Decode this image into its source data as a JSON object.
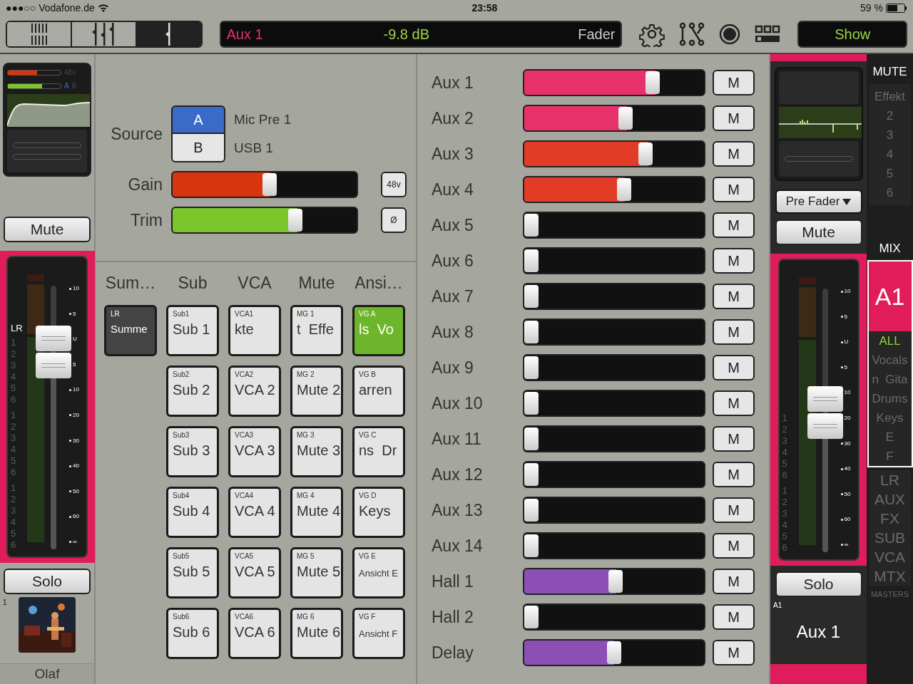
{
  "status_bar": {
    "carrier": "●●●○○ Vodafone.de",
    "time": "23:58",
    "battery": "59 %"
  },
  "toolbar": {
    "view_tabs": [
      {
        "selected": false
      },
      {
        "selected": false
      },
      {
        "selected": true
      }
    ],
    "display": {
      "channel": "Aux 1",
      "value": "-9.8 dB",
      "mode": "Fader"
    },
    "show_button": "Show"
  },
  "left_strip": {
    "overview": {
      "phantom": "48v",
      "source_a": "A",
      "source_b": "B",
      "gain": {
        "level": 0.55
      },
      "trim": {
        "level": 0.65
      }
    },
    "mute_button": "Mute",
    "fader": {
      "bus": "LR",
      "groups": [
        [
          "1",
          "2",
          "3",
          "4",
          "5",
          "6"
        ],
        [
          "1",
          "2",
          "3",
          "4",
          "5",
          "6"
        ],
        [
          "1",
          "2",
          "3",
          "4",
          "5",
          "6"
        ]
      ],
      "scale": [
        "10",
        "5",
        "U",
        "5",
        "10",
        "20",
        "30",
        "40",
        "50",
        "60",
        "∞"
      ],
      "level": 0.75
    },
    "solo_button": "Solo",
    "channel_number": "1",
    "channel_name": "Olaf"
  },
  "source_panel": {
    "source_label": "Source",
    "sources": [
      {
        "label": "A",
        "name": "Mic Pre 1",
        "selected": true
      },
      {
        "label": "B",
        "name": "USB 1",
        "selected": false
      }
    ],
    "controls": [
      {
        "label": "Gain",
        "level": 0.53,
        "color": "#d8350f",
        "button": "48v"
      },
      {
        "label": "Trim",
        "level": 0.68,
        "color": "#7cc62c",
        "button": "Ø"
      }
    ]
  },
  "groups": [
    {
      "heading": "Sum…",
      "kind": "sum",
      "items": [
        {
          "tag": "LR",
          "label": "Summe",
          "selected": true
        }
      ]
    },
    {
      "heading": "Sub",
      "kind": "group",
      "items": [
        {
          "tag": "Sub1",
          "label": "Sub 1",
          "selected": false
        },
        {
          "tag": "Sub2",
          "label": "Sub 2",
          "selected": false
        },
        {
          "tag": "Sub3",
          "label": "Sub 3",
          "selected": false
        },
        {
          "tag": "Sub4",
          "label": "Sub 4",
          "selected": false
        },
        {
          "tag": "Sub5",
          "label": "Sub 5",
          "selected": false
        },
        {
          "tag": "Sub6",
          "label": "Sub 6",
          "selected": false
        }
      ]
    },
    {
      "heading": "VCA",
      "kind": "group",
      "items": [
        {
          "tag": "VCA1",
          "label": "kte",
          "selected": false
        },
        {
          "tag": "VCA2",
          "label": "VCA 2",
          "selected": false
        },
        {
          "tag": "VCA3",
          "label": "VCA 3",
          "selected": false
        },
        {
          "tag": "VCA4",
          "label": "VCA 4",
          "selected": false
        },
        {
          "tag": "VCA5",
          "label": "VCA 5",
          "selected": false
        },
        {
          "tag": "VCA6",
          "label": "VCA 6",
          "selected": false
        }
      ]
    },
    {
      "heading": "Mute",
      "kind": "group",
      "items": [
        {
          "tag": "MG 1",
          "label": "t  Effe",
          "selected": false
        },
        {
          "tag": "MG 2",
          "label": "Mute 2",
          "selected": false
        },
        {
          "tag": "MG 3",
          "label": "Mute 3",
          "selected": false
        },
        {
          "tag": "MG 4",
          "label": "Mute 4",
          "selected": false
        },
        {
          "tag": "MG 5",
          "label": "Mute 5",
          "selected": false
        },
        {
          "tag": "MG 6",
          "label": "Mute 6",
          "selected": false
        }
      ]
    },
    {
      "heading": "Ansi…",
      "kind": "group",
      "items": [
        {
          "tag": "VG A",
          "label": "ls  Vo",
          "selected": true
        },
        {
          "tag": "VG B",
          "label": "arren",
          "selected": false
        },
        {
          "tag": "VG C",
          "label": "ns  Dr",
          "selected": false
        },
        {
          "tag": "VG D",
          "label": "Keys",
          "selected": false
        },
        {
          "tag": "VG E",
          "label": "Ansicht E",
          "selected": false
        },
        {
          "tag": "VG F",
          "label": "Ansicht F",
          "selected": false
        }
      ]
    }
  ],
  "aux_sends": [
    {
      "name": "Aux 1",
      "level": 0.73,
      "color": "#e8306a",
      "mute": "M",
      "muted": false
    },
    {
      "name": "Aux 2",
      "level": 0.57,
      "color": "#e8306a",
      "mute": "M",
      "muted": false
    },
    {
      "name": "Aux 3",
      "level": 0.69,
      "color": "#e23b26",
      "mute": "M",
      "muted": false
    },
    {
      "name": "Aux 4",
      "level": 0.56,
      "color": "#e23b26",
      "mute": "M",
      "muted": false
    },
    {
      "name": "Aux 5",
      "level": 0,
      "mute": "M",
      "muted": false
    },
    {
      "name": "Aux 6",
      "level": 0,
      "mute": "M",
      "muted": false
    },
    {
      "name": "Aux 7",
      "level": 0,
      "mute": "M",
      "muted": false
    },
    {
      "name": "Aux 8",
      "level": 0,
      "mute": "M",
      "muted": false
    },
    {
      "name": "Aux 9",
      "level": 0,
      "mute": "M",
      "muted": false
    },
    {
      "name": "Aux 10",
      "level": 0,
      "mute": "M",
      "muted": false
    },
    {
      "name": "Aux 11",
      "level": 0,
      "mute": "M",
      "muted": false
    },
    {
      "name": "Aux 12",
      "level": 0,
      "mute": "M",
      "muted": false
    },
    {
      "name": "Aux 13",
      "level": 0,
      "mute": "M",
      "muted": false
    },
    {
      "name": "Aux 14",
      "level": 0,
      "mute": "M",
      "muted": false
    },
    {
      "name": "Hall 1",
      "level": 0.51,
      "color": "#8b4fb5",
      "mute": "M",
      "muted": false
    },
    {
      "name": "Hall 2",
      "level": 0,
      "mute": "M",
      "muted": false
    },
    {
      "name": "Delay",
      "level": 0.5,
      "color": "#8b4fb5",
      "mute": "M",
      "muted": false
    }
  ],
  "right_strip": {
    "pre_fader": "Pre Fader",
    "mute_button": "Mute",
    "fader": {
      "groups": [
        [
          "1",
          "2",
          "3",
          "4",
          "5",
          "6"
        ],
        [
          "1",
          "2",
          "3",
          "4",
          "5",
          "6"
        ]
      ],
      "scale": [
        "10",
        "5",
        "U",
        "5",
        "10",
        "20",
        "30",
        "40",
        "50",
        "60",
        "∞"
      ],
      "level": 0.53
    },
    "solo_button": "Solo",
    "channel_tag": "A1",
    "channel_name": "Aux 1"
  },
  "sidebar": {
    "mute_heading": "MUTE",
    "mute_groups": [
      "Effekt",
      "2",
      "3",
      "4",
      "5",
      "6"
    ],
    "mix_heading": "MIX",
    "mix": "A1",
    "views": [
      {
        "label": "ALL",
        "selected": true
      },
      {
        "label": "Vocals",
        "selected": false
      },
      {
        "label": "n  Gita",
        "selected": false
      },
      {
        "label": "Drums",
        "selected": false
      },
      {
        "label": "Keys",
        "selected": false
      },
      {
        "label": "E",
        "selected": false
      },
      {
        "label": "F",
        "selected": false
      }
    ],
    "masters": [
      "LR",
      "AUX",
      "FX",
      "SUB",
      "VCA",
      "MTX"
    ],
    "masters_label": "MASTERS"
  }
}
